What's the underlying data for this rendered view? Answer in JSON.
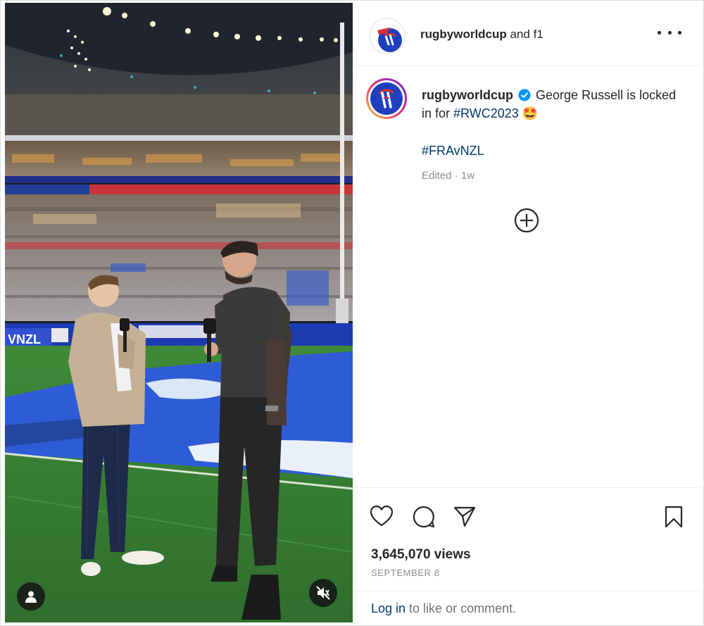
{
  "post": {
    "author": "rugbyworldcup",
    "conjunction": "and",
    "collaborator": "f1",
    "caption_text": "George Russell is locked in for",
    "hashtag_main": "#RWC2023",
    "emoji": "🤩",
    "hashtag_second": "#FRAvNZL",
    "meta": "Edited · 1w",
    "views": "3,645,070 views",
    "date": "SEPTEMBER 8"
  },
  "footer": {
    "login_label": "Log in",
    "login_rest": " to like or comment."
  },
  "icons": {
    "more": "more-options-icon",
    "add": "add-circle-icon",
    "like": "heart-icon",
    "comment": "comment-icon",
    "share": "share-icon",
    "save": "bookmark-icon",
    "user": "user-tag-icon",
    "mute": "muted-speaker-icon"
  },
  "colors": {
    "link": "#00376b",
    "brand_blue": "#1f3fbf",
    "brand_red": "#e0322f",
    "verified": "#0095f6"
  }
}
